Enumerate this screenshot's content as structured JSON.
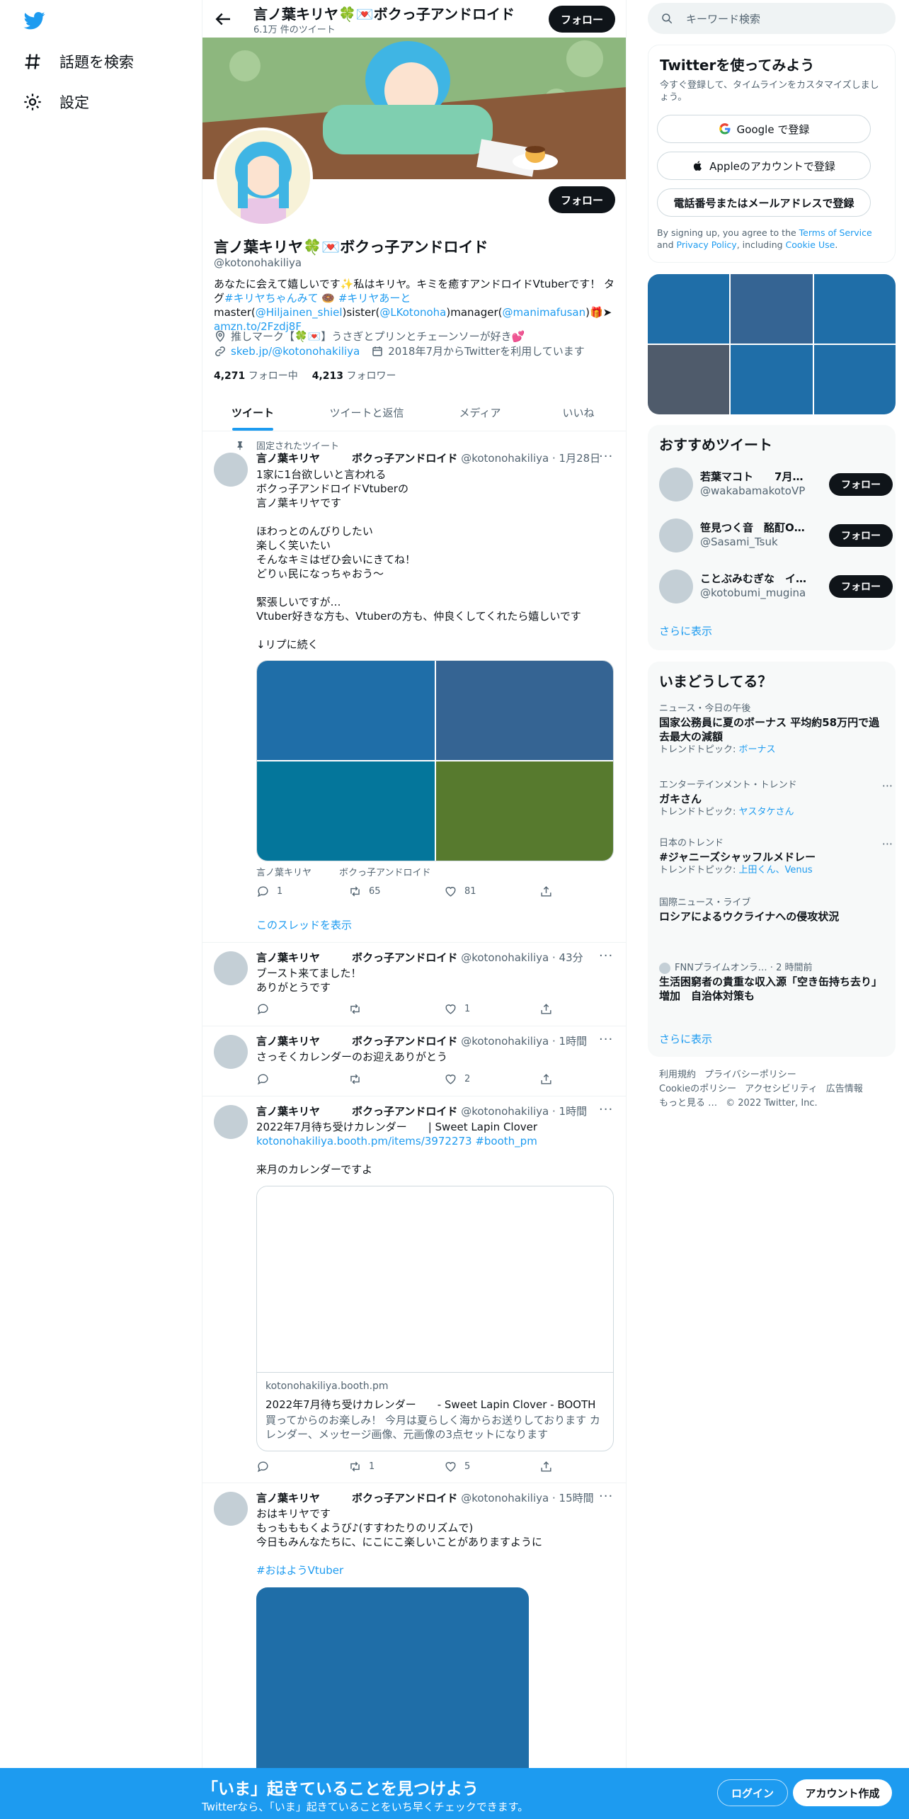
{
  "nav": {
    "logo_icon": "twitter-bird-icon",
    "items": [
      {
        "label": "話題を検索",
        "icon": "hashtag-icon"
      },
      {
        "label": "設定",
        "icon": "gear-icon"
      }
    ]
  },
  "header": {
    "name": "言ノ葉キリヤ🍀💌ボクっ子アンドロイド",
    "tweet_count": "6.1万 件のツイート",
    "follow_label": "フォロー"
  },
  "profile": {
    "name": "言ノ葉キリヤ🍀💌ボクっ子アンドロイド",
    "handle": "@kotonohakiliya",
    "follow_label": "フォロー",
    "bio_1": "あなたに会えて嬉しいです✨私はキリヤ。キミを癒すアンドロイドVtuberです！ タグ",
    "bio_tag1": "#キリヤちゃんみて",
    "bio_emoji": " 🍩 ",
    "bio_tag2": "#キリヤあーと",
    "bio_master": " master(",
    "bio_master_link": "@Hiljainen_shiel",
    "bio_sister": ")sister(",
    "bio_sister_link": "@LKotonoha",
    "bio_manager": ")manager(",
    "bio_manager_link": "@manimafusan",
    "bio_end": ")🎁➤ ",
    "bio_url": "amzn.to/2Fzdj8F",
    "location": "推しマーク【🍀💌】うさぎとプリンとチェーンソーが好き💕",
    "website": "skeb.jp/@kotonohakiliya",
    "joined": "2018年7月からTwitterを利用しています",
    "following_count": "4,271",
    "following_label": "フォロー中",
    "followers_count": "4,213",
    "followers_label": "フォロワー"
  },
  "tabs": [
    "ツイート",
    "ツイートと返信",
    "メディア",
    "いいね"
  ],
  "tweets": [
    {
      "pinned_label": "固定されたツイート",
      "name": "言ノ葉キリヤ　　　ボクっ子アンドロイド",
      "handle": "@kotonohakiliya · 1月28日",
      "text": "1家に1台欲しいと言われる\nボクっ子アンドロイドVtuberの\n言ノ葉キリヤです\n\nほわっとのんびりしたい\n楽しく笑いたい\nそんなキミはぜひ会いにきてね！\nどりぃ民になっちゃおう～\n\n緊張しいですが…\nVtuber好きな方も、Vtuberの方も、仲良くしてくれたら嬉しいです\n\n↓リプに続く",
      "media_colors": [
        "#1f6ea8",
        "#356493",
        "#04769b",
        "#577a2e"
      ],
      "media_caption": "言ノ葉キリヤ　　　ボクっ子アンドロイド",
      "replies": "1",
      "retweets": "65",
      "likes": "81",
      "thread_link": "このスレッドを表示"
    },
    {
      "name": "言ノ葉キリヤ　　　ボクっ子アンドロイド",
      "handle": "@kotonohakiliya · 43分",
      "text": "ブースト来てました！\nありがとうです",
      "replies": "",
      "retweets": "",
      "likes": "1"
    },
    {
      "name": "言ノ葉キリヤ　　　ボクっ子アンドロイド",
      "handle": "@kotonohakiliya · 1時間",
      "text": "さっそくカレンダーのお迎えありがとう",
      "replies": "",
      "retweets": "",
      "likes": "2"
    },
    {
      "name": "言ノ葉キリヤ　　　ボクっ子アンドロイド",
      "handle": "@kotonohakiliya · 1時間",
      "text": "2022年7月待ち受けカレンダー　　| Sweet Lapin Clover",
      "link_line": "kotonohakiliya.booth.pm/items/3972273 #booth_pm",
      "text2": "来月のカレンダーですよ",
      "card_domain": "kotonohakiliya.booth.pm",
      "card_title": "2022年7月待ち受けカレンダー　　- Sweet Lapin Clover - BOOTH",
      "card_desc": "買ってからのお楽しみ！ 今月は夏らしく海からお送りしております カレンダー、メッセージ画像、元画像の3点セットになります",
      "replies": "",
      "retweets": "1",
      "likes": "5"
    },
    {
      "name": "言ノ葉キリヤ　　　ボクっ子アンドロイド",
      "handle": "@kotonohakiliya · 15時間",
      "text": "おはキリヤです\nもっもももくようび♪(すすわたりのリズムで)\n今日もみんなたちに、にこにこ楽しいことがありますように",
      "hashtag": "#おはようVtuber",
      "media_color": "#1f6ea8"
    }
  ],
  "right": {
    "search_placeholder": "キーワード検索",
    "signup": {
      "title": "Twitterを使ってみよう",
      "subtitle": "今すぐ登録して、タイムラインをカスタマイズしましょう。",
      "google": "Google で登録",
      "apple": "Appleのアカウントで登録",
      "phone": "電話番号またはメールアドレスで登録",
      "terms_1": "By signing up, you agree to the ",
      "terms_link": "Terms of Service",
      "terms_2": " and ",
      "privacy_link": "Privacy Policy",
      "terms_3": ", including ",
      "cookie_link": "Cookie Use",
      "terms_4": "."
    },
    "photo_colors": [
      "#1f6ea8",
      "#356493",
      "#1f6ea8",
      "#4f5b6b",
      "#1f6ea8",
      "#1f6ea8"
    ],
    "recommend": {
      "title": "おすすめツイート",
      "items": [
        {
          "name": "若葉マコト　　7月7日…",
          "handle": "@wakabamakotoVP",
          "btn": "フォロー"
        },
        {
          "name": "笹見つく音　酩酊O…",
          "handle": "@Sasami_Tsuk",
          "btn": "フォロー"
        },
        {
          "name": "ことぶみむぎな　イ…",
          "handle": "@kotobumi_mugina",
          "btn": "フォロー"
        }
      ],
      "more": "さらに表示"
    },
    "trends": {
      "title": "いまどうしてる？",
      "items": [
        {
          "context": "ニュース・今日の午後",
          "title": "国家公務員に夏のボーナス 平均約58万円で過去最大の減額",
          "sub_label": "トレンドトピック: ",
          "sub_link": "ボーナス"
        },
        {
          "context": "エンターテインメント・トレンド",
          "title": "ガキさん",
          "sub_label": "トレンドトピック: ",
          "sub_link": "ヤスタケさん"
        },
        {
          "context": "日本のトレンド",
          "title": "#ジャニーズシャッフルメドレー",
          "sub_label": "トレンドトピック: ",
          "sub_link": "上田くん、Venus"
        },
        {
          "context": "国際ニュース・ライブ",
          "title": "ロシアによるウクライナへの侵攻状況",
          "sub_label": "",
          "sub_link": ""
        },
        {
          "context": "FNNプライムオンラ… · 2 時間前",
          "title": "生活困窮者の貴重な収入源「空き缶持ち去り」増加　自治体対策も",
          "sub_label": "",
          "sub_link": ""
        }
      ],
      "more": "さらに表示"
    },
    "footer": [
      "利用規約",
      "プライバシーポリシー",
      "Cookieのポリシー",
      "アクセシビリティ",
      "広告情報",
      "もっと見る …",
      "© 2022 Twitter, Inc."
    ]
  },
  "bottom": {
    "title": "「いま」起きていることを見つけよう",
    "subtitle": "Twitterなら、「いま」起きていることをいち早くチェックできます。",
    "login": "ログイン",
    "signup": "アカウント作成"
  }
}
